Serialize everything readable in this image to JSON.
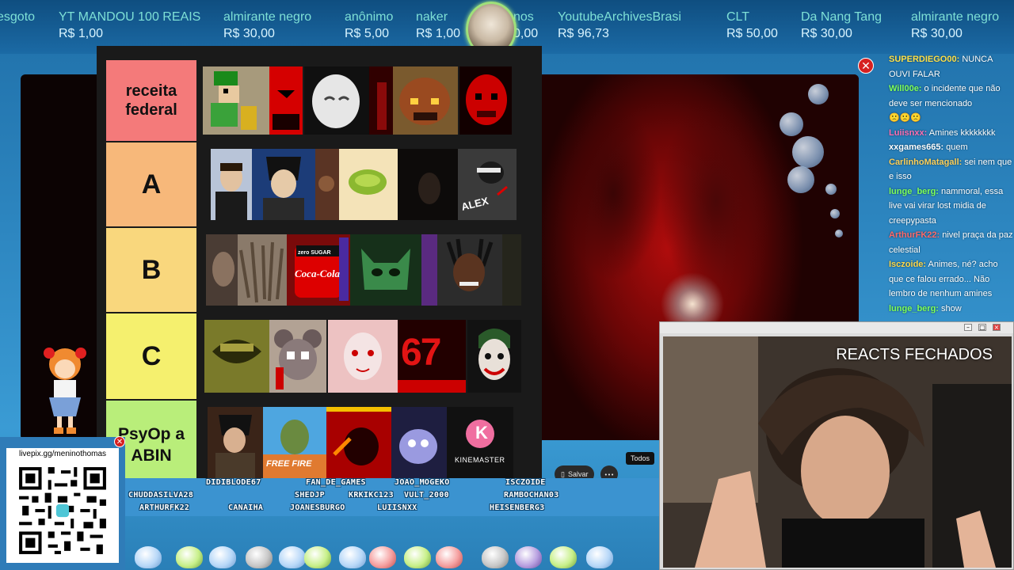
{
  "ticker": {
    "donations": [
      {
        "name": "esgoto",
        "value": ""
      },
      {
        "name": "YT MANDOU 100 REAIS",
        "value": "R$ 1,00"
      },
      {
        "name": "almirante negro",
        "value": "R$ 30,00"
      },
      {
        "name": "anônimo",
        "value": "R$ 5,00"
      },
      {
        "name": "naker",
        "value": "R$ 1,00"
      },
      {
        "name": "nos",
        "value": "0,00"
      },
      {
        "name": "YoutubeArchivesBrasi",
        "value": "R$ 96,73"
      },
      {
        "name": "CLT",
        "value": "R$ 50,00"
      },
      {
        "name": "Da Nang Tang",
        "value": "R$ 30,00"
      },
      {
        "name": "almirante negro",
        "value": "R$ 30,00"
      }
    ]
  },
  "tierlist": {
    "tiers": [
      {
        "label": "receita federal",
        "color": "#f47a7a"
      },
      {
        "label": "A",
        "color": "#f7b87a"
      },
      {
        "label": "B",
        "color": "#f9d77d"
      },
      {
        "label": "C",
        "color": "#f5f06e"
      },
      {
        "label": "PsyOp a ABIN",
        "color": "#b9ee7a"
      }
    ],
    "captions": {
      "cola_top": "zero SUGAR",
      "cola": "Coca-Cola",
      "alex": "ALEX",
      "six_seven": "67",
      "kinemaster_letter": "K",
      "kinemaster": "KINEMASTER",
      "free_fire": "FREE FIRE"
    }
  },
  "youtube": {
    "save_label": "Salvar",
    "more_label": "•••",
    "todos_label": "Todos"
  },
  "subs": [
    "DIDIBLODE67",
    "FAN_DE_GAMES",
    "JOAO_MOGEKO",
    "ISCZOIDE",
    "CHUDDASILVA28",
    "SHEDJP",
    "KRKIKC123",
    "VULT_2000",
    "RAMBOCHAN03",
    "ARTHURFK22",
    "CANAIHA",
    "JOANESBURGO",
    "LUIISNXX",
    "HEISENBERG3"
  ],
  "qr": {
    "label": "livepix.gg/meninothomas"
  },
  "chat": [
    {
      "user": "SUPERDIEGO00:",
      "color": "#ffe14a",
      "text": "NUNCA OUVI FALAR"
    },
    {
      "user": "Will00e:",
      "color": "#7fff5a",
      "text": "o incidente que não deve ser mencionado"
    },
    {
      "user": "",
      "color": "#ffffff",
      "text": "🙁🙁🙁"
    },
    {
      "user": "Luiisnxx:",
      "color": "#ff6fb1",
      "text": "Amines kkkkkkkk"
    },
    {
      "user": "xxgames665:",
      "color": "#ffffff",
      "text": "quem"
    },
    {
      "user": "CarlinhoMatagall:",
      "color": "#ffd15a",
      "text": "sei nem que e isso"
    },
    {
      "user": "lunge_berg:",
      "color": "#7fff5a",
      "text": "nammoral, essa live vai virar lost midia de creepypasta"
    },
    {
      "user": "ArthurFK22:",
      "color": "#ff6a6a",
      "text": "nivel praça da paz celestial"
    },
    {
      "user": "Isczoide:",
      "color": "#ffd84a",
      "text": "Animes, né? acho que ce falou errado... Não lembro de nenhum amines"
    },
    {
      "user": "lunge_berg:",
      "color": "#7fff5a",
      "text": "show"
    }
  ],
  "cam": {
    "caption": "REACTS FECHADOS"
  },
  "colors": {
    "close_red": "#d62020",
    "ticker_name": "#7ee0d6",
    "overlay_blue": "#2d86c0"
  }
}
